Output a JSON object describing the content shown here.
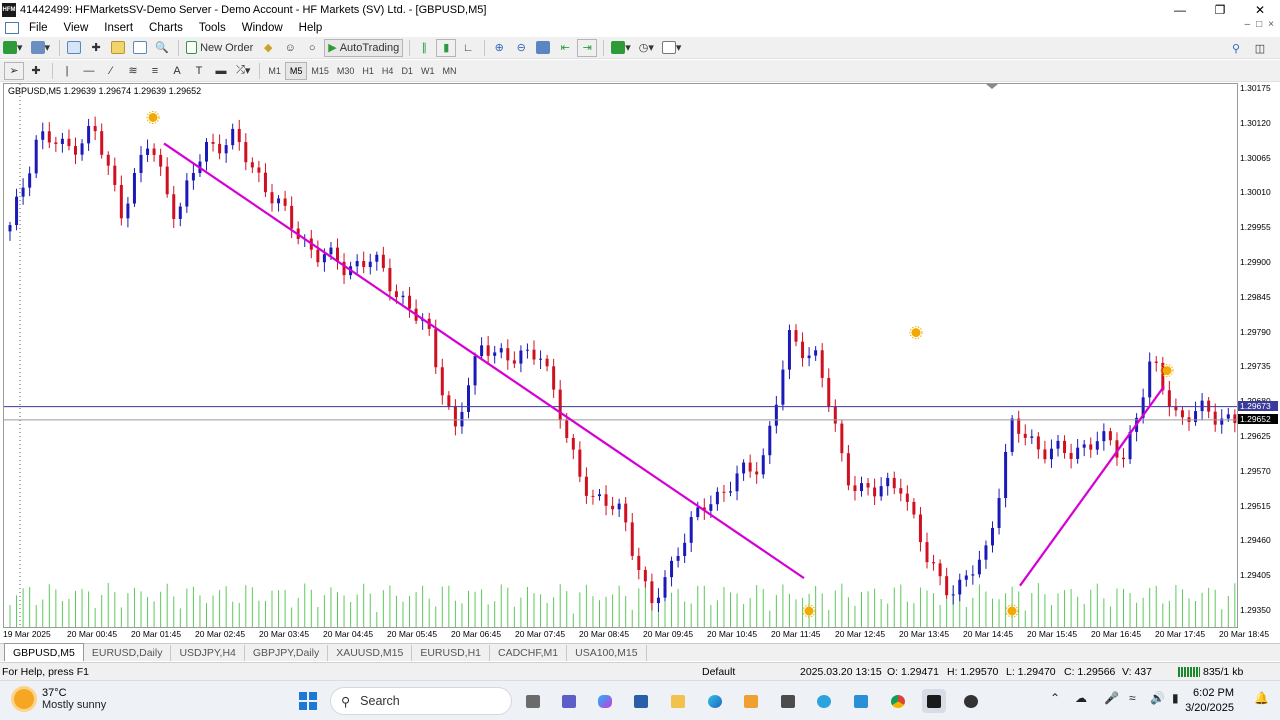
{
  "window": {
    "title": "41442499: HFMarketsSV-Demo Server - Demo Account - HF Markets (SV) Ltd. - [GBPUSD,M5]",
    "app_icon_text": "HFM"
  },
  "menu": [
    "File",
    "View",
    "Insert",
    "Charts",
    "Tools",
    "Window",
    "Help"
  ],
  "toolbar": {
    "new_order_label": "New Order",
    "autotrading_label": "AutoTrading"
  },
  "timeframes": [
    "M1",
    "M5",
    "M15",
    "M30",
    "H1",
    "H4",
    "D1",
    "W1",
    "MN"
  ],
  "active_timeframe": "M5",
  "chart": {
    "header": "GBPUSD,M5  1.29639 1.29674 1.29639 1.29652",
    "price_ticks": [
      "1.30175",
      "1.30120",
      "1.30065",
      "1.30010",
      "1.29955",
      "1.29900",
      "1.29845",
      "1.29790",
      "1.29735",
      "1.29680",
      "1.29625",
      "1.29570",
      "1.29515",
      "1.29460",
      "1.29405",
      "1.29350"
    ],
    "ask_tag": "1.29673",
    "bid_tag": "1.29652",
    "time_labels": [
      "19 Mar 2025",
      "20 Mar 00:45",
      "20 Mar 01:45",
      "20 Mar 02:45",
      "20 Mar 03:45",
      "20 Mar 04:45",
      "20 Mar 05:45",
      "20 Mar 06:45",
      "20 Mar 07:45",
      "20 Mar 08:45",
      "20 Mar 09:45",
      "20 Mar 10:45",
      "20 Mar 11:45",
      "20 Mar 12:45",
      "20 Mar 13:45",
      "20 Mar 14:45",
      "20 Mar 15:45",
      "20 Mar 16:45",
      "20 Mar 17:45",
      "20 Mar 18:45"
    ],
    "colors": {
      "bull": "#1a1ab8",
      "bear": "#d01020",
      "volume": "#5cc85c",
      "trendline": "#d400d4",
      "fractal": "#f2a900",
      "ask_line": "#3a3a9a",
      "bid_line": "#9a9a9a"
    }
  },
  "chart_tabs": [
    "GBPUSD,M5",
    "EURUSD,Daily",
    "USDJPY,H4",
    "GBPJPY,Daily",
    "XAUUSD,M15",
    "EURUSD,H1",
    "CADCHF,M1",
    "USA100,M15"
  ],
  "status": {
    "help": "For Help, press F1",
    "profile": "Default",
    "datetime": "2025.03.20 13:15",
    "open": "O: 1.29471",
    "high": "H: 1.29570",
    "low": "L: 1.29470",
    "close": "C: 1.29566",
    "volume": "V: 437",
    "traffic": "835/1 kb"
  },
  "taskbar": {
    "temperature": "37°C",
    "weather": "Mostly sunny",
    "search_placeholder": "Search",
    "time": "6:02 PM",
    "date": "3/20/2025"
  },
  "chart_data": {
    "type": "candlestick",
    "symbol": "GBPUSD",
    "timeframe": "M5",
    "ylim": [
      1.2932,
      1.302
    ],
    "x_range": [
      "19 Mar 2025",
      "20 Mar 18:45"
    ],
    "series": [
      {
        "name": "GBPUSD,M5",
        "values": [
          1.29952,
          1.30105,
          1.30078,
          1.30112,
          1.29985,
          1.3009,
          1.29975,
          1.30085,
          1.30095,
          1.30035,
          1.29965,
          1.29915,
          1.29895,
          1.29905,
          1.2985,
          1.2979,
          1.29635,
          1.2978,
          1.2974,
          1.2977,
          1.2962,
          1.2952,
          1.29512,
          1.2935,
          1.2945,
          1.2952,
          1.29555,
          1.29585,
          1.29775,
          1.29755,
          1.29565,
          1.29535,
          1.29555,
          1.2942,
          1.2938,
          1.29435,
          1.2964,
          1.2961,
          1.29595,
          1.29625,
          1.29595,
          1.2974,
          1.29655,
          1.29665,
          1.29652
        ]
      }
    ]
  }
}
